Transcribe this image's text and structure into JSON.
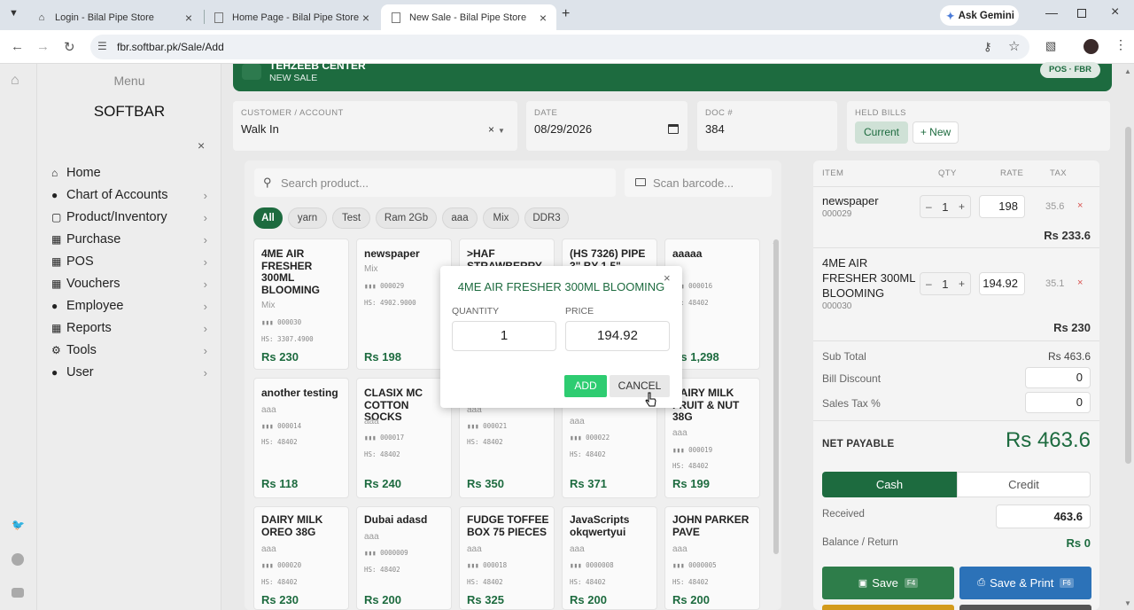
{
  "browser": {
    "tabs": [
      {
        "title": "Login - Bilal Pipe Store"
      },
      {
        "title": "Home Page - Bilal Pipe Store"
      },
      {
        "title": "New Sale - Bilal Pipe Store"
      }
    ],
    "ask_gemini": "Ask Gemini",
    "url": "fbr.softbar.pk/Sale/Add"
  },
  "sidebar": {
    "menu_title": "Menu",
    "brand": "SOFTBAR",
    "items": [
      {
        "label": "Home",
        "icon": "home-icon"
      },
      {
        "label": "Chart of Accounts",
        "icon": "user-icon"
      },
      {
        "label": "Product/Inventory",
        "icon": "cart-icon"
      },
      {
        "label": "Purchase",
        "icon": "document-icon"
      },
      {
        "label": "POS",
        "icon": "document-icon"
      },
      {
        "label": "Vouchers",
        "icon": "document-icon"
      },
      {
        "label": "Employee",
        "icon": "user-icon"
      },
      {
        "label": "Reports",
        "icon": "document-icon"
      },
      {
        "label": "Tools",
        "icon": "gear-icon"
      },
      {
        "label": "User",
        "icon": "user-icon"
      }
    ]
  },
  "header": {
    "company": "TEHZEEB CENTER",
    "subtitle": "NEW SALE",
    "badge": "POS · FBR"
  },
  "form": {
    "customer_label": "CUSTOMER / ACCOUNT",
    "customer_value": "Walk In",
    "date_label": "DATE",
    "date_value": "08/29/2026",
    "doc_label": "DOC #",
    "doc_value": "384",
    "held_label": "HELD BILLS",
    "current_label": "Current",
    "new_label": "+ New"
  },
  "products": {
    "search_placeholder": "Search product...",
    "scan_placeholder": "Scan barcode...",
    "chips": [
      "All",
      "yarn",
      "Test",
      "Ram 2Gb",
      "aaa",
      "Mix",
      "DDR3"
    ],
    "cards": [
      {
        "name": "4ME AIR FRESHER 300ML BLOOMING",
        "cat": "Mix",
        "code": "000030",
        "hs": "HS: 3307.4900",
        "price": "Rs 230"
      },
      {
        "name": "newspaper",
        "cat": "Mix",
        "code": "000029",
        "hs": "HS: 4902.9000",
        "price": "Rs 198"
      },
      {
        "name": ">HAF STRAWBERRY",
        "cat": "",
        "code": "",
        "hs": "",
        "price": ""
      },
      {
        "name": "(HS 7326) PIPE 3\" BY 1.5\"",
        "cat": "",
        "code": "",
        "hs": "",
        "price": ""
      },
      {
        "name": "aaaaa",
        "cat": "",
        "code": "000016",
        "hs": "HS: 48402",
        "price": "Rs 1,298"
      },
      {
        "name": "another testing",
        "cat": "aaa",
        "code": "000014",
        "hs": "HS: 48402",
        "price": "Rs 118"
      },
      {
        "name": "CLASIX MC COTTON SOCKS",
        "cat": "aaa",
        "code": "000017",
        "hs": "HS: 48402",
        "price": "Rs 240"
      },
      {
        "name": "",
        "cat": "aaa",
        "code": "000021",
        "hs": "HS: 48402",
        "price": "Rs 350"
      },
      {
        "name": "",
        "cat": "aaa",
        "code": "000022",
        "hs": "HS: 48402",
        "price": "Rs 371"
      },
      {
        "name": "DAIRY MILK FRUIT & NUT 38G",
        "cat": "aaa",
        "code": "000019",
        "hs": "HS: 48402",
        "price": "Rs 199"
      },
      {
        "name": "DAIRY MILK OREO 38G",
        "cat": "aaa",
        "code": "000020",
        "hs": "HS: 48402",
        "price": "Rs 230"
      },
      {
        "name": "Dubai adasd",
        "cat": "aaa",
        "code": "0000009",
        "hs": "HS: 48402",
        "price": "Rs 200"
      },
      {
        "name": "FUDGE TOFFEE BOX 75 PIECES",
        "cat": "aaa",
        "code": "000018",
        "hs": "HS: 48402",
        "price": "Rs 325"
      },
      {
        "name": "JavaScripts okqwertyui",
        "cat": "aaa",
        "code": "0000008",
        "hs": "HS: 48402",
        "price": "Rs 200"
      },
      {
        "name": "JOHN PARKER PAVE",
        "cat": "aaa",
        "code": "0000005",
        "hs": "HS: 48402",
        "price": "Rs 200"
      }
    ]
  },
  "cart": {
    "headers": {
      "item": "ITEM",
      "qty": "QTY",
      "rate": "RATE",
      "tax": "TAX"
    },
    "items": [
      {
        "name": "newspaper",
        "code": "000029",
        "qty": "1",
        "rate": "198",
        "tax": "35.6",
        "total": "Rs 233.6"
      },
      {
        "name": "4ME AIR FRESHER 300ML BLOOMING",
        "code": "000030",
        "qty": "1",
        "rate": "194.92",
        "tax": "35.1",
        "total": "Rs 230"
      }
    ],
    "subtotal_label": "Sub Total",
    "subtotal_value": "Rs 463.6",
    "discount_label": "Bill Discount",
    "discount_value": "0",
    "tax_label": "Sales Tax %",
    "tax_value": "0",
    "net_label": "NET PAYABLE",
    "net_value": "Rs 463.6",
    "cash_label": "Cash",
    "credit_label": "Credit",
    "received_label": "Received",
    "received_value": "463.6",
    "balance_label": "Balance / Return",
    "balance_value": "Rs 0",
    "save_label": "Save",
    "save_key": "F4",
    "saveprint_label": "Save & Print",
    "saveprint_key": "F6"
  },
  "modal": {
    "title": "4ME AIR FRESHER 300ML BLOOMING",
    "qty_label": "QUANTITY",
    "qty_value": "1",
    "price_label": "PRICE",
    "price_value": "194.92",
    "add_label": "ADD",
    "cancel_label": "CANCEL"
  },
  "colors": {
    "primary": "#1d6b3f",
    "add": "#2ecc71",
    "saveprint": "#2c72b8"
  }
}
